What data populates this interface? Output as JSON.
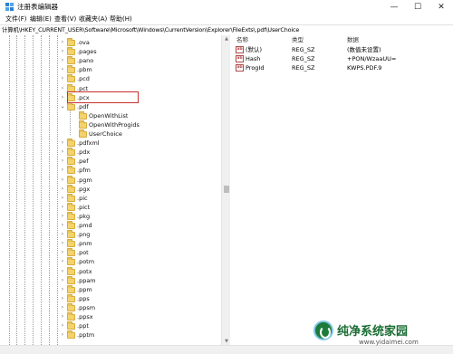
{
  "window": {
    "title": "注册表编辑器",
    "icon": "regedit-icon",
    "controls": {
      "minimize": "—",
      "maximize": "☐",
      "close": "✕"
    }
  },
  "menu": [
    "文件(F)",
    "编辑(E)",
    "查看(V)",
    "收藏夹(A)",
    "帮助(H)"
  ],
  "address": "计算机\\HKEY_CURRENT_USER\\Software\\Microsoft\\Windows\\CurrentVersion\\Explorer\\FileExts\\.pdf\\UserChoice",
  "tree": {
    "items": [
      {
        "label": ".ova",
        "level": 1,
        "expander": "›"
      },
      {
        "label": ".pages",
        "level": 1,
        "expander": "›"
      },
      {
        "label": ".pano",
        "level": 1,
        "expander": "›"
      },
      {
        "label": ".pbm",
        "level": 1,
        "expander": "›"
      },
      {
        "label": ".pcd",
        "level": 1,
        "expander": "›"
      },
      {
        "label": ".pct",
        "level": 1,
        "expander": "›"
      },
      {
        "label": ".pcx",
        "level": 1,
        "expander": "›"
      },
      {
        "label": ".pdf",
        "level": 1,
        "expander": "⌄"
      },
      {
        "label": "OpenWithList",
        "level": 2,
        "expander": ""
      },
      {
        "label": "OpenWithProgids",
        "level": 2,
        "expander": ""
      },
      {
        "label": "UserChoice",
        "level": 2,
        "expander": "",
        "selected": true
      },
      {
        "label": ".pdfxml",
        "level": 1,
        "expander": "›"
      },
      {
        "label": ".pdx",
        "level": 1,
        "expander": "›"
      },
      {
        "label": ".pef",
        "level": 1,
        "expander": "›"
      },
      {
        "label": ".pfm",
        "level": 1,
        "expander": "›"
      },
      {
        "label": ".pgm",
        "level": 1,
        "expander": "›"
      },
      {
        "label": ".pgx",
        "level": 1,
        "expander": "›"
      },
      {
        "label": ".pic",
        "level": 1,
        "expander": "›"
      },
      {
        "label": ".pict",
        "level": 1,
        "expander": "›"
      },
      {
        "label": ".pkg",
        "level": 1,
        "expander": "›"
      },
      {
        "label": ".pmd",
        "level": 1,
        "expander": "›"
      },
      {
        "label": ".png",
        "level": 1,
        "expander": "›"
      },
      {
        "label": ".pnm",
        "level": 1,
        "expander": "›"
      },
      {
        "label": ".pot",
        "level": 1,
        "expander": "›"
      },
      {
        "label": ".potm",
        "level": 1,
        "expander": "›"
      },
      {
        "label": ".potx",
        "level": 1,
        "expander": "›"
      },
      {
        "label": ".ppam",
        "level": 1,
        "expander": "›"
      },
      {
        "label": ".ppm",
        "level": 1,
        "expander": "›"
      },
      {
        "label": ".pps",
        "level": 1,
        "expander": "›"
      },
      {
        "label": ".ppsm",
        "level": 1,
        "expander": "›"
      },
      {
        "label": ".ppsx",
        "level": 1,
        "expander": "›"
      },
      {
        "label": ".ppt",
        "level": 1,
        "expander": "›"
      },
      {
        "label": ".pptm",
        "level": 1,
        "expander": "›"
      }
    ]
  },
  "values": {
    "headers": [
      "名称",
      "类型",
      "数据"
    ],
    "rows": [
      {
        "name": "(默认)",
        "type": "REG_SZ",
        "data": "(数值未设置)",
        "icon": "ab"
      },
      {
        "name": "Hash",
        "type": "REG_SZ",
        "data": "+PON/WzaaUU=",
        "icon": "ab"
      },
      {
        "name": "ProgId",
        "type": "REG_SZ",
        "data": "KWPS.PDF.9",
        "icon": "ab"
      }
    ]
  },
  "watermark": {
    "text": "纯净系统家园",
    "url": "www.yidaimei.com"
  },
  "colors": {
    "highlight_border": "#c9302c",
    "folder": "#f3d36e"
  }
}
